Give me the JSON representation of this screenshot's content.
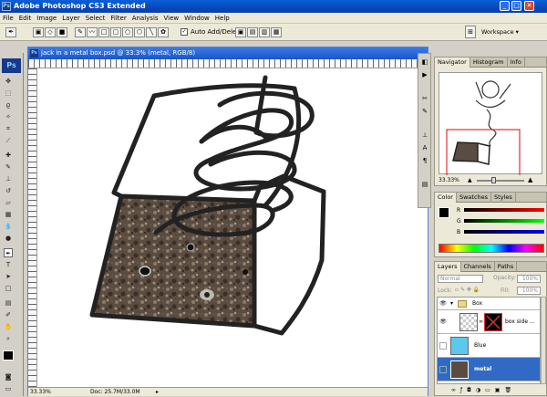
{
  "app": {
    "title": "Adobe Photoshop CS3 Extended",
    "logo": "Ps"
  },
  "menu": [
    "File",
    "Edit",
    "Image",
    "Layer",
    "Select",
    "Filter",
    "Analysis",
    "View",
    "Window",
    "Help"
  ],
  "options": {
    "auto_add_delete": "Auto Add/Delete",
    "workspace": "Workspace"
  },
  "document": {
    "title": "jack in a metal box.psd @ 33.3% (metal, RGB/8)",
    "zoom": "33.33%",
    "doc_size": "Doc: 25.7M/33.0M"
  },
  "navigator": {
    "tabs": [
      "Navigator",
      "Histogram",
      "Info"
    ],
    "zoom": "33.33%"
  },
  "color": {
    "tabs": [
      "Color",
      "Swatches",
      "Styles"
    ],
    "channels": [
      {
        "label": "R",
        "value": "0"
      },
      {
        "label": "G",
        "value": "0"
      },
      {
        "label": "B",
        "value": "0"
      }
    ]
  },
  "layers": {
    "tabs": [
      "Layers",
      "Channels",
      "Paths"
    ],
    "blend_mode": "Normal",
    "opacity_label": "Opacity:",
    "opacity": "100%",
    "lock_label": "Lock:",
    "fill_label": "Fill:",
    "fill": "100%",
    "items": [
      {
        "name": "Box",
        "type": "group"
      },
      {
        "name": "box side ...",
        "type": "masked"
      },
      {
        "name": "Blue",
        "type": "fill",
        "color": "#5bc8f0"
      },
      {
        "name": "metal",
        "type": "image",
        "selected": true
      }
    ]
  },
  "colors": {
    "title_blue": "#0848b8",
    "selection": "#316ac5"
  }
}
